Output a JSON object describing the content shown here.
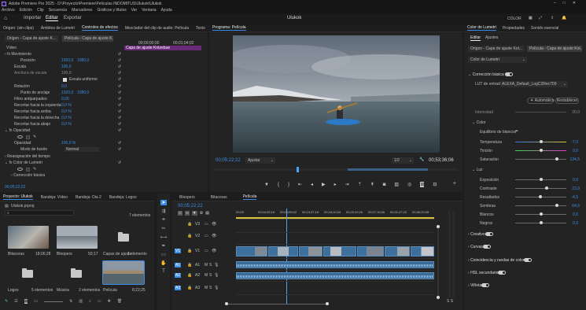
{
  "title_bar": {
    "app_title": "Adobe Premiere Pro 2025 - D:\\Proyecto\\Premiere\\Películas INDOMITUS\\Ulukok\\Ulukok"
  },
  "menu": [
    "Archivo",
    "Edición",
    "Clip",
    "Secuencia",
    "Marcadores",
    "Gráficos y títulos",
    "Ver",
    "Ventana",
    "Ayuda"
  ],
  "workspace": {
    "tabs": [
      "Importar",
      "Editar",
      "Exportar"
    ],
    "active": "Editar",
    "project": "Ulukok",
    "color_label": "COLOR"
  },
  "source_panel": {
    "tabs": [
      "Origen: (sin clips)",
      "Ámbitos de Lumetri",
      "Controles de efectos",
      "Mezclador del clip de audio: Película",
      "Texto"
    ],
    "source_label": "Origen - Capa de ajuste K...",
    "target_label": "Película - Capa de ajuste K...",
    "time_a": "00;00;00;00",
    "time_b": "00;01;04;02",
    "clip_label": "Capa de ajuste Kotzebue",
    "section_video": "Vídeo",
    "movement": "Movimiento",
    "position_label": "Posición",
    "position_x": "1920,0",
    "position_y": "1080,0",
    "scale_label": "Escala",
    "scale_value": "100,0",
    "scale_width_label": "Anchura de escala",
    "scale_width_value": "100,0",
    "uniform_scale": "Escala uniforme",
    "rotation_label": "Rotación",
    "rotation_value": "0,0",
    "anchor_label": "Punto de anclaje",
    "anchor_x": "1920,0",
    "anchor_y": "1080,0",
    "antiflicker_label": "Filtro antiparpadeo",
    "antiflicker_value": "0,00",
    "crop_left_label": "Recortar hacia la izquierda",
    "crop_left_value": "0,0 %",
    "crop_top_label": "Recortar hacia arriba",
    "crop_top_value": "0,0 %",
    "crop_right_label": "Recortar hacia la derecha",
    "crop_right_value": "0,0 %",
    "crop_bottom_label": "Recortar hacia abajo",
    "crop_bottom_value": "0,0 %",
    "opacity": "Opacidad",
    "opacity_label": "Opacidad",
    "opacity_value": "100,0 %",
    "blend_label": "Modo de fusión",
    "blend_value": "Normal",
    "time_remap": "Reasignación del tiempo",
    "lumetri": "Color de Lumetri",
    "basic_correction": "Corrección básica",
    "timecode": "00;05;22;22"
  },
  "program": {
    "tab": "Programa: Película",
    "timecode": "00;05;22;22",
    "fit": "Ajustar",
    "res": "1/2",
    "duration": "00;53;36;06",
    "playhead_progress": 0.34
  },
  "project": {
    "tabs": [
      "Proyecto: Ulukok",
      "Bandeja: Vídeo",
      "Bandeja: Dia 2",
      "Bandeja: Logos"
    ],
    "file": "Ulukok.prproj",
    "count": "7 elementos",
    "items": [
      {
        "name": "Bitacoras",
        "meta": "18;06;28",
        "kind": "video"
      },
      {
        "name": "Bloopers",
        "meta": "50;17",
        "kind": "video"
      },
      {
        "name": "Capas de ajuste",
        "meta": "1 elemento",
        "kind": "folder"
      },
      {
        "name": "Logos",
        "meta": "5 elementos",
        "kind": "folder"
      },
      {
        "name": "Música",
        "meta": "2 elementos",
        "kind": "folder"
      },
      {
        "name": "Película",
        "meta": "8;22;25",
        "kind": "video"
      }
    ]
  },
  "timeline": {
    "tabs": [
      "Bloopers",
      "Bitacoras",
      "Película"
    ],
    "active": "Película",
    "timecode": "00;05;22;22",
    "ruler": [
      "00;00",
      "00;04;32;16",
      "00;09;05;02",
      "00;13;37;18",
      "00;18;10;04",
      "00;22;42;20",
      "00;27;15;06",
      "00;31;47;22",
      "00;36;20;08"
    ],
    "video_tracks": [
      "V3",
      "V2",
      "V1"
    ],
    "audio_tracks": [
      "A1",
      "A2",
      "A3"
    ],
    "meter_label": "S S"
  },
  "lumetri": {
    "tabs": [
      "Color de Lumetri",
      "Propiedades",
      "Sonido esencial"
    ],
    "sub_tabs": [
      "Editar",
      "Ajustes"
    ],
    "source_label": "Origen - Capa de ajuste Kot...",
    "target_label": "Película - Capa de ajuste Kot...",
    "effect": "Color de Lumetri",
    "basic": "Corrección básica",
    "lut_label": "LUT de entrada",
    "lut_value": "ALEXA_Default_LogC2Rec709",
    "auto_btn": "Automático",
    "reset_btn": "Restablecer",
    "intensity_label": "Intensidad",
    "intensity_value": "20,0",
    "color_section": "Color",
    "wb_label": "Equilibrio de blancos",
    "temp_label": "Temperatura",
    "temp_value": "-7,0",
    "tint_label": "Tinción",
    "tint_value": "0,0",
    "sat_label": "Saturación",
    "sat_value": "134,5",
    "light_section": "Luz",
    "exposure_label": "Exposición",
    "exposure_value": "0,0",
    "contrast_label": "Contraste",
    "contrast_value": "23,9",
    "highlights_label": "Resaltados",
    "highlights_value": "-4,5",
    "shadows_label": "Sombras",
    "shadows_value": "64,6",
    "whites_label": "Blancos",
    "whites_value": "0,0",
    "blacks_label": "Negros",
    "blacks_value": "0,0",
    "sections": [
      "Creativo",
      "Curvas",
      "Coincidencia y ruedas de color",
      "HSL secundario",
      "Viñeta"
    ]
  },
  "colors": {
    "accent": "#3a8ee6",
    "clip": "#3c6f9c",
    "label_purple": "#6a2a7a"
  }
}
